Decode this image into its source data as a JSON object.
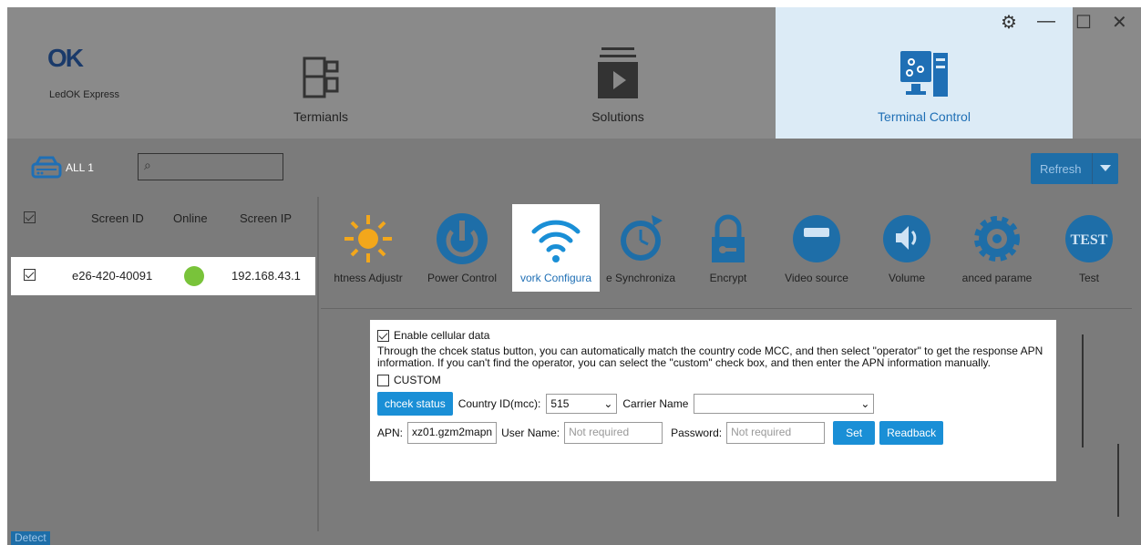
{
  "app": {
    "logo": "OK",
    "name": "LedOK Express"
  },
  "nav": [
    {
      "label": "Termianls",
      "icon": "terminals-icon"
    },
    {
      "label": "Solutions",
      "icon": "solutions-icon"
    },
    {
      "label": "Terminal Control",
      "icon": "terminal-control-icon",
      "active": true
    }
  ],
  "toolbar": {
    "all_label": "ALL 1",
    "search_placeholder": "",
    "refresh_label": "Refresh"
  },
  "table": {
    "headers": [
      "Screen ID",
      "Online",
      "Screen IP"
    ],
    "rows": [
      {
        "screen_id": "e26-420-40091",
        "online": true,
        "screen_ip": "192.168.43.1",
        "checked": true
      }
    ]
  },
  "tabs": [
    {
      "label": "htness Adjustr",
      "icon": "brightness-icon"
    },
    {
      "label": "Power Control",
      "icon": "power-icon"
    },
    {
      "label": "vork Configura",
      "icon": "wifi-icon",
      "active": true
    },
    {
      "label": "e Synchroniza",
      "icon": "time-sync-icon"
    },
    {
      "label": "Encrypt",
      "icon": "lock-icon"
    },
    {
      "label": "Video source",
      "icon": "video-source-icon"
    },
    {
      "label": "Volume",
      "icon": "volume-icon"
    },
    {
      "label": "anced parame",
      "icon": "advanced-gear-icon"
    },
    {
      "label": "Test",
      "icon": "test-icon"
    }
  ],
  "cellular": {
    "enable_label": "Enable cellular data",
    "description": "Through the chcek status button, you can automatically match the country code MCC, and then select \"operator\" to get the response APN information. If you can't find the operator, you can select the \"custom\" check box, and then enter the APN information manually.",
    "custom_label": "CUSTOM",
    "check_status_label": "chcek status",
    "country_label": "Country ID(mcc):",
    "country_value": "515",
    "carrier_label": "Carrier Name",
    "carrier_value": "",
    "apn_label": "APN:",
    "apn_value": "xz01.gzm2mapn",
    "user_label": "User Name:",
    "user_placeholder": "Not required",
    "password_label": "Password:",
    "password_placeholder": "Not required",
    "set_label": "Set",
    "readback_label": "Readback"
  },
  "status": {
    "detect_label": "Detect"
  },
  "colors": {
    "accent": "#1a8fd6",
    "nav_active": "#dcebf6",
    "online": "#79c33a",
    "bg": "#7b7b7b"
  }
}
